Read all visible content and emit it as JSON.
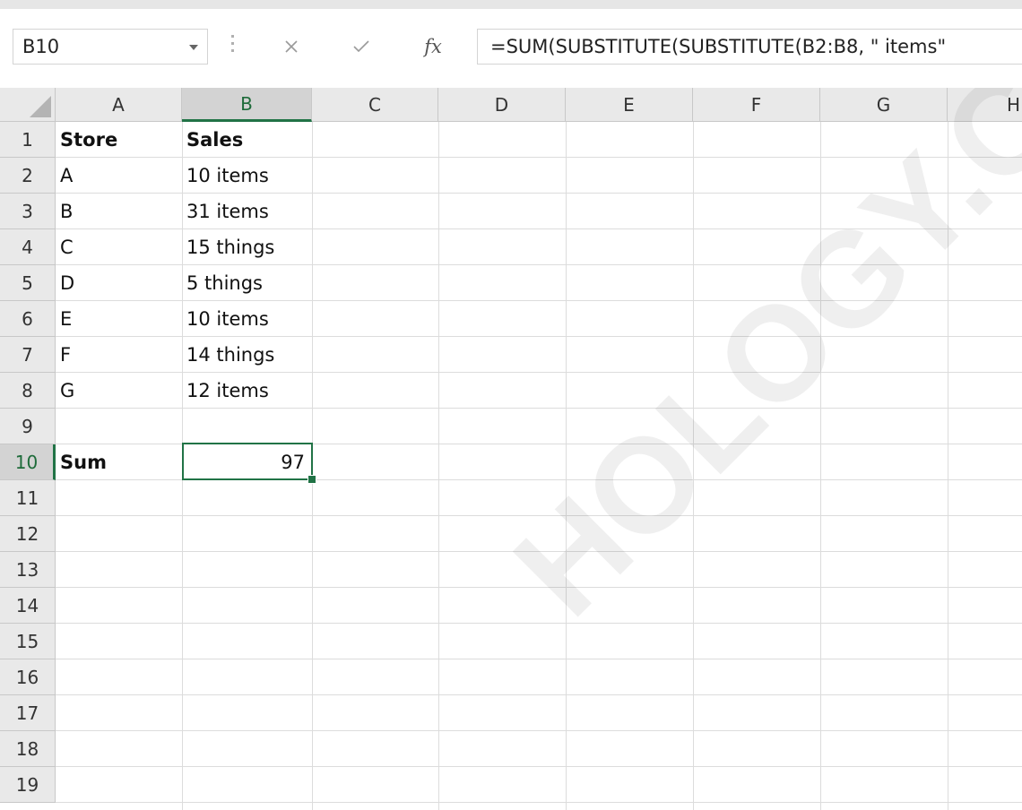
{
  "formula_bar": {
    "name_box": "B10",
    "formula": "=SUM(SUBSTITUTE(SUBSTITUTE(B2:B8, \" items\""
  },
  "icons": {
    "name_box_dropdown": "chevron-down-icon",
    "cancel": "close-icon",
    "enter": "check-icon",
    "insert_function": "fx-icon"
  },
  "columns": [
    "A",
    "B",
    "C",
    "D",
    "E",
    "F",
    "G",
    "H"
  ],
  "rows": [
    "1",
    "2",
    "3",
    "4",
    "5",
    "6",
    "7",
    "8",
    "9",
    "10",
    "11",
    "12",
    "13",
    "14",
    "15",
    "16",
    "17",
    "18",
    "19"
  ],
  "cells": {
    "A1": "Store",
    "B1": "Sales",
    "A2": "A",
    "B2": "10 items",
    "A3": "B",
    "B3": "31 items",
    "A4": "C",
    "B4": "15 things",
    "A5": "D",
    "B5": "5 things",
    "A6": "E",
    "B6": "10 items",
    "A7": "F",
    "B7": "14 things",
    "A8": "G",
    "B8": "12 items",
    "A10": "Sum",
    "B10": "97"
  },
  "selection": {
    "active_cell": "B10",
    "active_column": "B",
    "active_row": "10"
  },
  "colors": {
    "accent": "#217346",
    "header_bg": "#e9e9e9",
    "gridline": "#dcdcdc"
  },
  "watermark_text": "HOLOGY.COM"
}
